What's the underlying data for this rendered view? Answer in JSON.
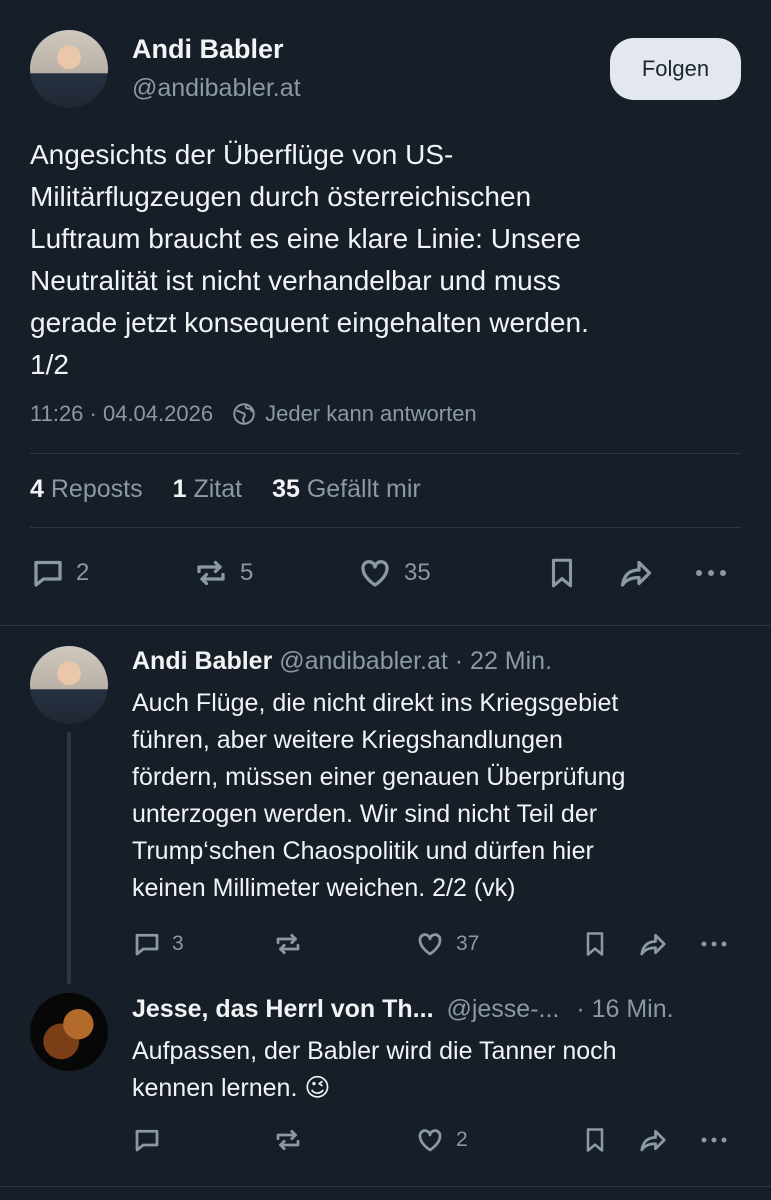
{
  "main_post": {
    "author_name": "Andi Babler",
    "author_handle": "@andibabler.at",
    "follow_label": "Folgen",
    "text_lines": [
      "Angesichts der Überflüge von US-",
      "Militärflugzeugen durch österreichischen",
      "Luftraum braucht es eine klare Linie: Unsere",
      "Neutralität ist nicht verhandelbar und muss",
      "gerade jetzt konsequent eingehalten werden.",
      "1/2"
    ],
    "timestamp": "11:26 · 04.04.2026",
    "reply_setting": "Jeder kann antworten",
    "stats": {
      "reposts_count": "4",
      "reposts_label": "Reposts",
      "quotes_count": "1",
      "quotes_label": "Zitat",
      "likes_count": "35",
      "likes_label": "Gefällt mir"
    },
    "actions": {
      "replies": "2",
      "reposts": "5",
      "likes": "35"
    }
  },
  "reply1": {
    "author_name": "Andi Babler",
    "author_handle": "@andibabler.at",
    "time": "· 22 Min.",
    "text_lines": [
      "Auch Flüge, die nicht direkt ins Kriegsgebiet",
      "führen, aber weitere Kriegshandlungen",
      "fördern, müssen einer genauen Überprüfung",
      "unterzogen werden. Wir sind nicht Teil der",
      "Trump‘schen Chaospolitik und dürfen hier",
      "keinen Millimeter weichen. 2/2 (vk)"
    ],
    "actions": {
      "replies": "3",
      "likes": "37"
    }
  },
  "reply2": {
    "author_name": "Jesse, das Herrl von Th...",
    "author_handle": "@jesse-...",
    "time": "· 16 Min.",
    "text_lines": [
      "Aufpassen, der Babler wird die Tanner noch",
      "kennen lernen. 😉"
    ],
    "actions": {
      "likes": "2"
    }
  },
  "icons": {
    "reply": "speech-bubble-icon",
    "repost": "repost-arrows-icon",
    "like": "heart-icon",
    "bookmark": "bookmark-icon",
    "share": "share-arrow-icon",
    "more": "ellipsis-icon",
    "globe": "globe-icon"
  },
  "colors": {
    "background": "#161e27",
    "text": "#f1f3f5",
    "muted": "#8b98a5",
    "divider": "#2c3845",
    "follow_button": "#e3e8ee"
  }
}
